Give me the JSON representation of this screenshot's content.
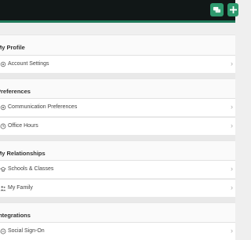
{
  "topbar": {
    "icons": [
      "chat-icon",
      "plus-icon"
    ]
  },
  "sections": [
    {
      "title": "My Profile",
      "items": [
        {
          "label": "Account Settings",
          "icon": "gear-icon"
        }
      ]
    },
    {
      "title": "Preferences",
      "items": [
        {
          "label": "Communication Preferences",
          "icon": "gear-icon"
        },
        {
          "label": "Office Hours",
          "icon": "clock-icon"
        }
      ]
    },
    {
      "title": "My Relationships",
      "items": [
        {
          "label": "Schools & Classes",
          "icon": "school-icon"
        },
        {
          "label": "My Family",
          "icon": "family-icon"
        }
      ]
    },
    {
      "title": "Integrations",
      "items": [
        {
          "label": "Social Sign-On",
          "icon": "link-icon"
        }
      ]
    }
  ],
  "colors": {
    "topbar": "#111717",
    "accent": "#2e9a6e"
  }
}
